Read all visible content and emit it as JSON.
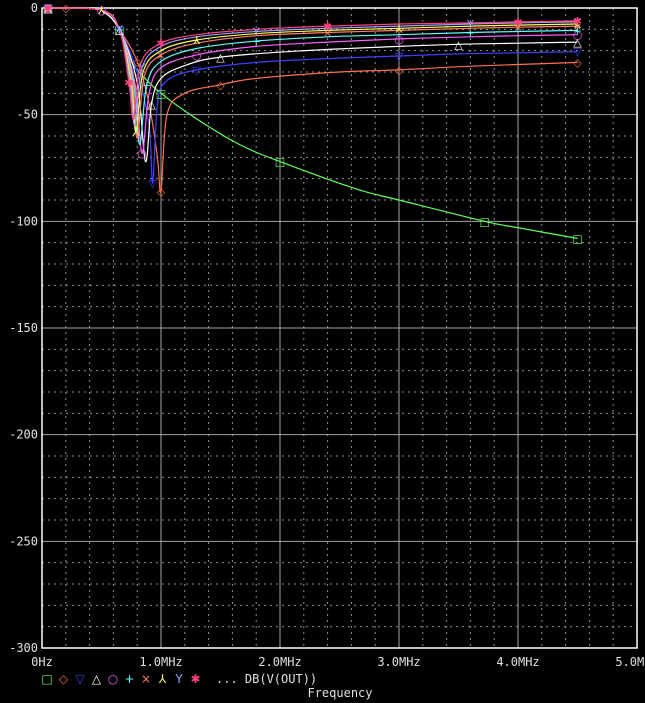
{
  "chart_data": {
    "type": "line",
    "xlabel": "Frequency",
    "x_tick_labels": [
      "0Hz",
      "1.0MHz",
      "2.0MHz",
      "3.0MHz",
      "4.0MHz",
      "5.0MHz"
    ],
    "y_tick_labels": [
      "0",
      "-50",
      "-100",
      "-150",
      "-200",
      "-250",
      "-300"
    ],
    "xlim_mhz": [
      0,
      5
    ],
    "ylim_db": [
      -300,
      0
    ],
    "grid": true,
    "legend_placement": "bottom-left",
    "legend_text": "... DB(V(OUT))",
    "colors": {
      "background": "#000000",
      "axis": "#ffffff",
      "grid": "#c0c0c0",
      "tick_text": "#e0e0e0"
    },
    "series": [
      {
        "marker": "□",
        "color": "#60ff60",
        "x": [
          0.05,
          0.3,
          0.5,
          0.65,
          0.75,
          0.85,
          1.0,
          1.3,
          1.66,
          2.0,
          2.65,
          3.0,
          3.72,
          4.0,
          4.5
        ],
        "y": [
          0,
          0,
          -1,
          -10,
          -25,
          -32,
          -40,
          -52,
          -64,
          -72,
          -85,
          -90,
          -100,
          -103,
          -108
        ]
      },
      {
        "marker": "◇",
        "color": "#ff7050",
        "x": [
          0.05,
          0.2,
          0.5,
          0.65,
          0.8,
          0.9,
          0.97,
          1.0,
          1.05,
          1.2,
          1.5,
          1.8,
          2.5,
          3.0,
          3.5,
          4.0,
          4.5
        ],
        "y": [
          0,
          0,
          -1,
          -10,
          -25,
          -45,
          -70,
          -86,
          -50,
          -40,
          -36,
          -33,
          -30,
          -29,
          -27.5,
          -26.5,
          -25.5
        ]
      },
      {
        "marker": "▽",
        "color": "#4040ff",
        "x": [
          0.05,
          0.5,
          0.65,
          0.8,
          0.9,
          0.93,
          0.97,
          1.05,
          1.3,
          1.8,
          2.5,
          3.0,
          3.5,
          4.0,
          4.5
        ],
        "y": [
          0,
          -1,
          -10,
          -30,
          -55,
          -82,
          -45,
          -34,
          -29,
          -25.5,
          -23.5,
          -22.5,
          -21.5,
          -21,
          -20.5
        ]
      },
      {
        "marker": "△",
        "color": "#ffffff",
        "x": [
          0.05,
          0.45,
          0.5,
          0.65,
          0.8,
          0.87,
          0.92,
          1.0,
          1.2,
          1.5,
          2.2,
          3.0,
          3.5,
          4.0,
          4.5
        ],
        "y": [
          0,
          0,
          -1,
          -10,
          -35,
          -72,
          -45,
          -33,
          -27,
          -23,
          -20,
          -18,
          -17,
          -16.5,
          -16
        ]
      },
      {
        "marker": "○",
        "color": "#ff60ff",
        "x": [
          0.05,
          0.5,
          0.65,
          0.78,
          0.84,
          0.9,
          1.0,
          1.3,
          1.8,
          2.4,
          3.0,
          3.6,
          4.0,
          4.5
        ],
        "y": [
          0,
          -1,
          -10,
          -35,
          -68,
          -40,
          -28,
          -22,
          -18,
          -16,
          -14.5,
          -13.5,
          -13,
          -12.5
        ]
      },
      {
        "marker": "+",
        "color": "#60ffff",
        "x": [
          0.05,
          0.5,
          0.65,
          0.77,
          0.82,
          0.88,
          1.0,
          1.3,
          1.8,
          2.4,
          3.0,
          3.6,
          4.0,
          4.5
        ],
        "y": [
          0,
          -1,
          -10,
          -35,
          -64,
          -36,
          -25,
          -19,
          -15.5,
          -13.5,
          -12.5,
          -11.5,
          -11,
          -10.5
        ]
      },
      {
        "marker": "×",
        "color": "#ff8060",
        "x": [
          0.05,
          0.5,
          0.65,
          0.76,
          0.8,
          0.86,
          1.0,
          1.3,
          1.8,
          2.4,
          3.0,
          3.6,
          4.0,
          4.5
        ],
        "y": [
          0,
          -1,
          -10,
          -35,
          -61,
          -32,
          -22,
          -16.5,
          -13,
          -11.5,
          -10.5,
          -9.5,
          -9,
          -8.5
        ]
      },
      {
        "marker": "⅄",
        "color": "#ffff60",
        "x": [
          0.05,
          0.5,
          0.65,
          0.75,
          0.79,
          0.85,
          1.0,
          1.3,
          1.8,
          2.4,
          3.0,
          3.6,
          4.0,
          4.5
        ],
        "y": [
          0,
          -1,
          -10,
          -35,
          -58,
          -30,
          -20,
          -15,
          -12,
          -10.5,
          -9.5,
          -8.5,
          -8,
          -7.5
        ]
      },
      {
        "marker": "Y",
        "color": "#a0a0ff",
        "x": [
          0.05,
          0.5,
          0.65,
          0.74,
          0.78,
          0.84,
          1.0,
          1.3,
          1.8,
          2.4,
          3.0,
          3.6,
          4.0,
          4.5
        ],
        "y": [
          0,
          -1,
          -10,
          -35,
          -55,
          -28,
          -18,
          -13.5,
          -11,
          -9.5,
          -8.5,
          -7.5,
          -7,
          -6.5
        ]
      },
      {
        "marker": "✱",
        "color": "#ff4080",
        "x": [
          0.05,
          0.5,
          0.65,
          0.73,
          0.77,
          0.83,
          1.0,
          1.3,
          1.8,
          2.4,
          3.0,
          3.6,
          4.0,
          4.5
        ],
        "y": [
          0,
          -1,
          -10,
          -35,
          -52,
          -26,
          -16.5,
          -12.5,
          -10,
          -8.5,
          -7.5,
          -7,
          -6.5,
          -6
        ]
      }
    ]
  }
}
